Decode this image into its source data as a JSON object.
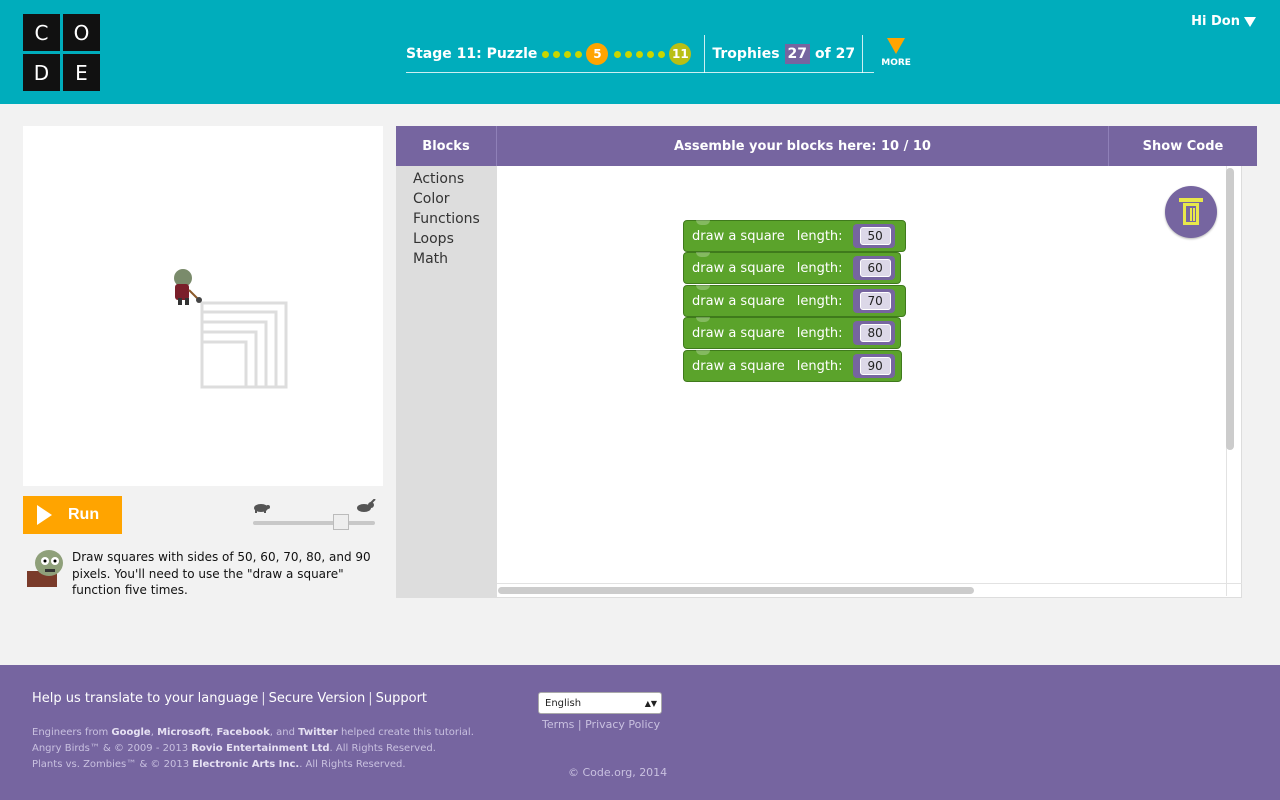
{
  "header": {
    "logo_letters": [
      "C",
      "O",
      "D",
      "E"
    ],
    "stage_label": "Stage 11: Puzzle",
    "current_puzzle": "5",
    "last_puzzle": "11",
    "trophies_label": "Trophies",
    "trophies_count": "27",
    "trophies_total": "of 27",
    "more_label": "MORE",
    "user_greeting": "Hi Don"
  },
  "run": {
    "label": "Run"
  },
  "speed": {
    "level": 0.75
  },
  "instructions": {
    "text": "Draw squares with sides of 50, 60, 70, 80, and 90 pixels. You'll need to use the \"draw a square\" function five times."
  },
  "workspace": {
    "blocks_tab": "Blocks",
    "assemble_label": "Assemble your blocks here: 10 / 10",
    "show_code": "Show Code",
    "toolbox": [
      "Actions",
      "Color",
      "Functions",
      "Loops",
      "Math"
    ],
    "blocks": [
      {
        "label": "draw a square",
        "param": "length:",
        "value": "50"
      },
      {
        "label": "draw a square",
        "param": "length:",
        "value": "60"
      },
      {
        "label": "draw a square",
        "param": "length:",
        "value": "70"
      },
      {
        "label": "draw a square",
        "param": "length:",
        "value": "80"
      },
      {
        "label": "draw a square",
        "param": "length:",
        "value": "90"
      }
    ]
  },
  "footer": {
    "translate": "Help us translate to your language",
    "secure": "Secure Version",
    "support": "Support",
    "credits_1_pre": "Engineers from ",
    "credits_1_google": "Google",
    "credits_1_ms": "Microsoft",
    "credits_1_fb": "Facebook",
    "credits_1_and": ", and ",
    "credits_1_tw": "Twitter",
    "credits_1_post": " helped create this tutorial.",
    "credits_2_pre": "Angry Birds™ & © 2009 - 2013 ",
    "credits_2_bold": "Rovio Entertainment Ltd",
    "credits_2_post": ". All Rights Reserved.",
    "credits_3_pre": "Plants vs. Zombies™ & © 2013 ",
    "credits_3_bold": "Electronic Arts Inc.",
    "credits_3_post": ". All Rights Reserved.",
    "language": "English",
    "terms": "Terms",
    "privacy": "Privacy Policy",
    "copyright": "© Code.org, 2014"
  },
  "colors": {
    "header_bg": "#00adbc",
    "purple": "#7665a0",
    "orange": "#ffa400",
    "block_green": "#5ba32b"
  }
}
